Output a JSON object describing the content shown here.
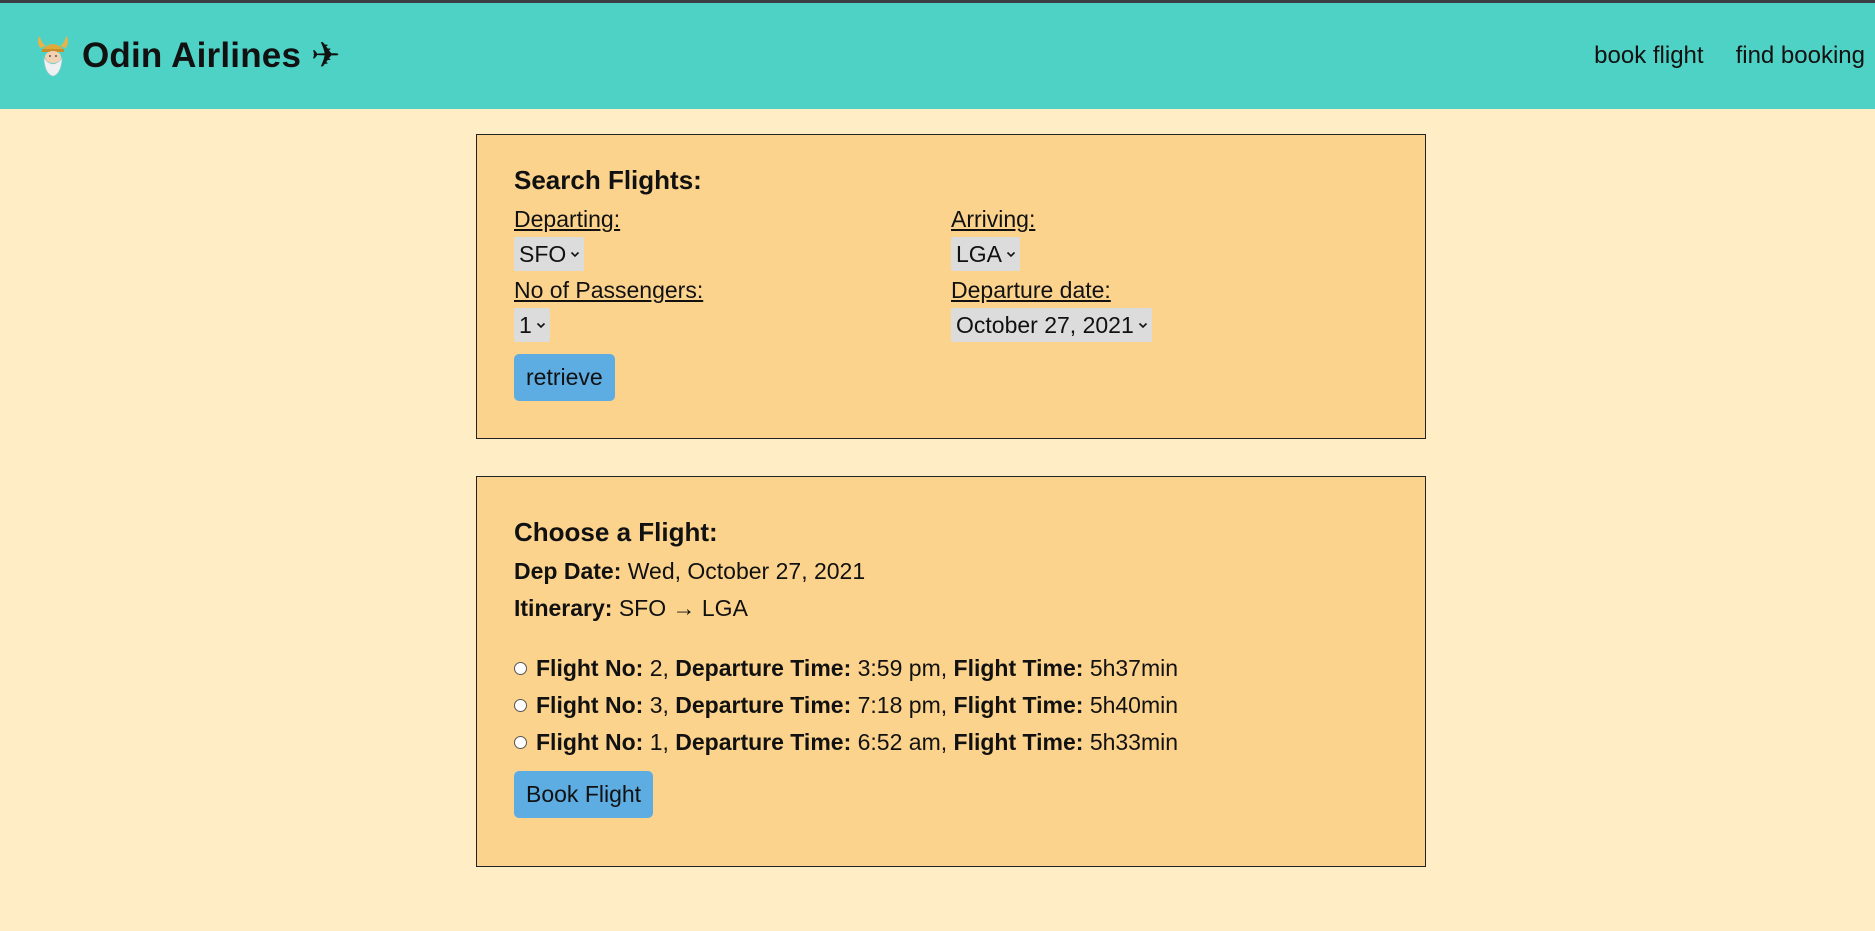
{
  "header": {
    "logo_icon": "odin-viking-icon",
    "title": "Odin Airlines ✈",
    "nav": [
      "book flight",
      "find booking"
    ]
  },
  "search": {
    "heading": "Search Flights:",
    "departing_label": "Departing:",
    "departing_value": "SFO",
    "arriving_label": "Arriving:",
    "arriving_value": "LGA",
    "passengers_label": "No of Passengers:",
    "passengers_value": "1",
    "date_label": "Departure date:",
    "date_value": "October 27, 2021",
    "button": "retrieve"
  },
  "choose": {
    "heading": "Choose a Flight:",
    "dep_date_label": "Dep Date:",
    "dep_date_value": "Wed, October 27, 2021",
    "itinerary_label": "Itinerary:",
    "itinerary_value": "SFO → LGA",
    "flight_no_label": "Flight No:",
    "dep_time_label": "Departure Time:",
    "flight_time_label": "Flight Time:",
    "flights": [
      {
        "no": "2",
        "dep_time": "3:59 pm",
        "flight_time": "5h37min",
        "selected": false
      },
      {
        "no": "3",
        "dep_time": "7:18 pm",
        "flight_time": "5h40min",
        "selected": false
      },
      {
        "no": "1",
        "dep_time": "6:52 am",
        "flight_time": "5h33min",
        "selected": false
      }
    ],
    "button": "Book Flight"
  },
  "colors": {
    "page_bg": "#ffedc6",
    "navbar_bg": "#4fd2c6",
    "panel_bg": "#fbd38d",
    "button_bg": "#5dade2"
  }
}
